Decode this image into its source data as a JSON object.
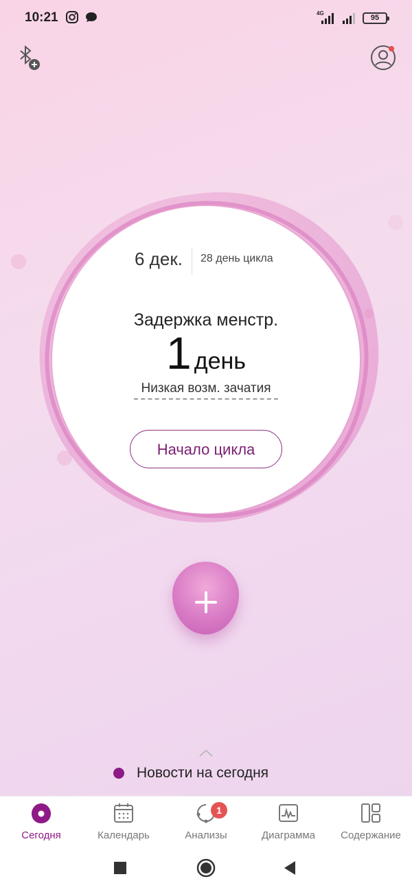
{
  "status_bar": {
    "time": "10:21",
    "network": "4G",
    "battery": "95"
  },
  "main": {
    "date": "6 дек.",
    "cycle_day": "28 день цикла",
    "delay_label": "Задержка менстр.",
    "delay_days": "1",
    "delay_unit": "день",
    "fertility": "Низкая возм. зачатия",
    "start_cycle_button": "Начало цикла"
  },
  "news": {
    "label": "Новости на сегодня"
  },
  "bottom_nav": {
    "items": [
      {
        "label": "Сегодня",
        "icon": "today-icon",
        "active": true
      },
      {
        "label": "Календарь",
        "icon": "calendar-icon",
        "active": false
      },
      {
        "label": "Анализы",
        "icon": "analysis-icon",
        "active": false,
        "badge": "1"
      },
      {
        "label": "Диаграмма",
        "icon": "chart-icon",
        "active": false
      },
      {
        "label": "Содержание",
        "icon": "content-icon",
        "active": false
      }
    ]
  },
  "colors": {
    "accent": "#8d1a86",
    "badge": "#e45454",
    "bubble": "#d97bc6"
  }
}
